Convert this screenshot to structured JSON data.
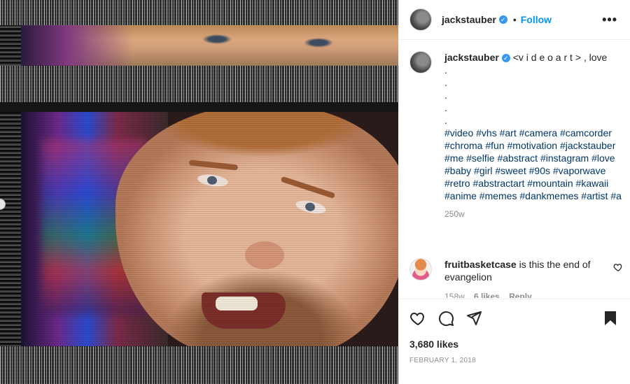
{
  "post": {
    "author": "jackstauber",
    "follow_label": "Follow",
    "separator": "•",
    "more_label": "•••",
    "caption_text": "<v i d e o a r t > , love",
    "caption_dots": [
      ".",
      ".",
      ".",
      ".",
      "."
    ],
    "hashtags": "#video #vhs #art #camera #camcorder #chroma #fun #motivation #jackstauber #me #selfie #abstract #instagram #love #baby #girl #sweet #90s #vaporwave #retro #abstractart #mountain #kawaii #anime #memes #dankmemes #artist #a",
    "caption_time": "250w"
  },
  "comment": {
    "user": "fruitbasketcase",
    "text": "is this the end of evangelion",
    "time": "158w",
    "likes": "6 likes",
    "reply_label": "Reply"
  },
  "footer": {
    "likes": "3,680 likes",
    "date": "FEBRUARY 1, 2018"
  },
  "icons": {
    "verified": "verified-badge-icon",
    "like": "heart-icon",
    "comment": "comment-icon",
    "share": "paper-plane-icon",
    "save": "bookmark-icon"
  },
  "colors": {
    "link_blue": "#0095f6",
    "verified_blue": "#3897f0",
    "hashtag_blue": "#00376b",
    "muted_gray": "#8e8e8e"
  }
}
